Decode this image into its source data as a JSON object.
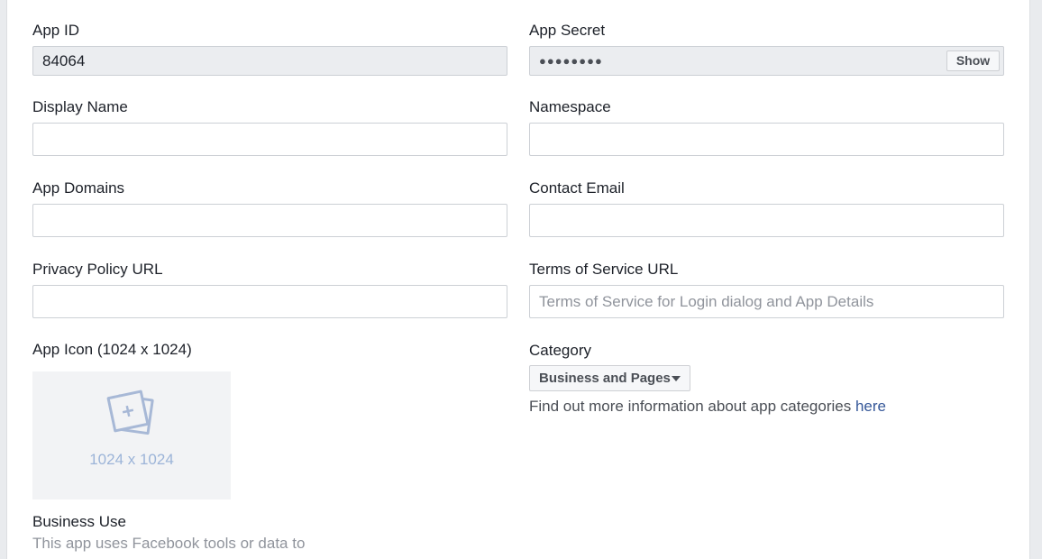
{
  "app_id": {
    "label": "App ID",
    "value": "84064"
  },
  "app_secret": {
    "label": "App Secret",
    "masked": "●●●●●●●●",
    "show_label": "Show"
  },
  "display_name": {
    "label": "Display Name",
    "value": ""
  },
  "namespace": {
    "label": "Namespace",
    "value": ""
  },
  "app_domains": {
    "label": "App Domains",
    "value": ""
  },
  "contact_email": {
    "label": "Contact Email",
    "value": ""
  },
  "privacy_policy": {
    "label": "Privacy Policy URL",
    "value": ""
  },
  "terms_of_service": {
    "label": "Terms of Service URL",
    "value": "",
    "placeholder": "Terms of Service for Login dialog and App Details"
  },
  "app_icon": {
    "label": "App Icon (1024 x 1024)",
    "size_text": "1024 x 1024",
    "icon": "photo-add-icon"
  },
  "category": {
    "label": "Category",
    "selected": "Business and Pages",
    "info_text": "Find out more information about app categories ",
    "info_link": "here"
  },
  "business_use": {
    "label": "Business Use",
    "description": "This app uses Facebook tools or data to"
  }
}
